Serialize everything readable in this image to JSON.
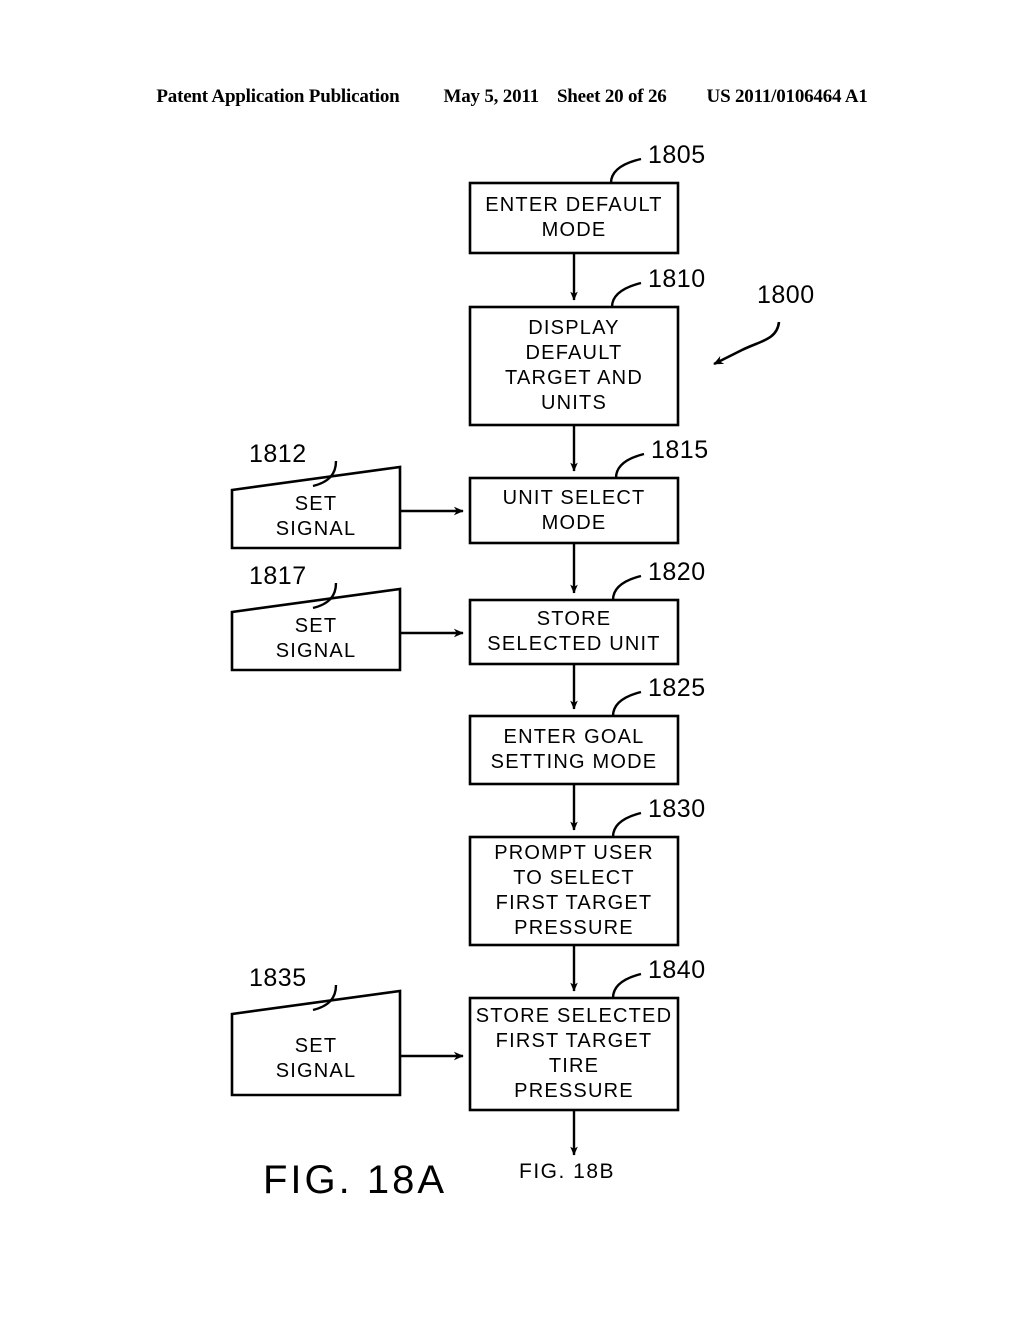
{
  "header": {
    "publication": "Patent Application Publication",
    "date": "May 5, 2011",
    "sheet": "Sheet 20 of 26",
    "patent_number": "US 2011/0106464 A1"
  },
  "figure": {
    "overall_ref": "1800",
    "caption": "FIG. 18A",
    "continuation_caption": "FIG. 18B",
    "line_color": "#000000",
    "background": "#ffffff",
    "nodes": [
      {
        "id": "1805",
        "shape": "process",
        "ref": "1805",
        "text": "ENTER DEFAULT\nMODE"
      },
      {
        "id": "1810",
        "shape": "process",
        "ref": "1810",
        "text": "DISPLAY\nDEFAULT\nTARGET  AND\nUNITS"
      },
      {
        "id": "1812",
        "shape": "manual-input",
        "ref": "1812",
        "text": "SET\nSIGNAL"
      },
      {
        "id": "1815",
        "shape": "process",
        "ref": "1815",
        "text": "UNIT  SELECT\nMODE"
      },
      {
        "id": "1817",
        "shape": "manual-input",
        "ref": "1817",
        "text": "SET\nSIGNAL"
      },
      {
        "id": "1820",
        "shape": "process",
        "ref": "1820",
        "text": "STORE\nSELECTED  UNIT"
      },
      {
        "id": "1825",
        "shape": "process",
        "ref": "1825",
        "text": "ENTER  GOAL\nSETTING  MODE"
      },
      {
        "id": "1830",
        "shape": "process",
        "ref": "1830",
        "text": "PROMPT USER\nTO SELECT\nFIRST  TARGET\nPRESSURE"
      },
      {
        "id": "1835",
        "shape": "manual-input",
        "ref": "1835",
        "text": "SET\nSIGNAL"
      },
      {
        "id": "1840",
        "shape": "process",
        "ref": "1840",
        "text": "STORE  SELECTED\nFIRST  TARGET\nTIRE\nPRESSURE"
      }
    ]
  }
}
